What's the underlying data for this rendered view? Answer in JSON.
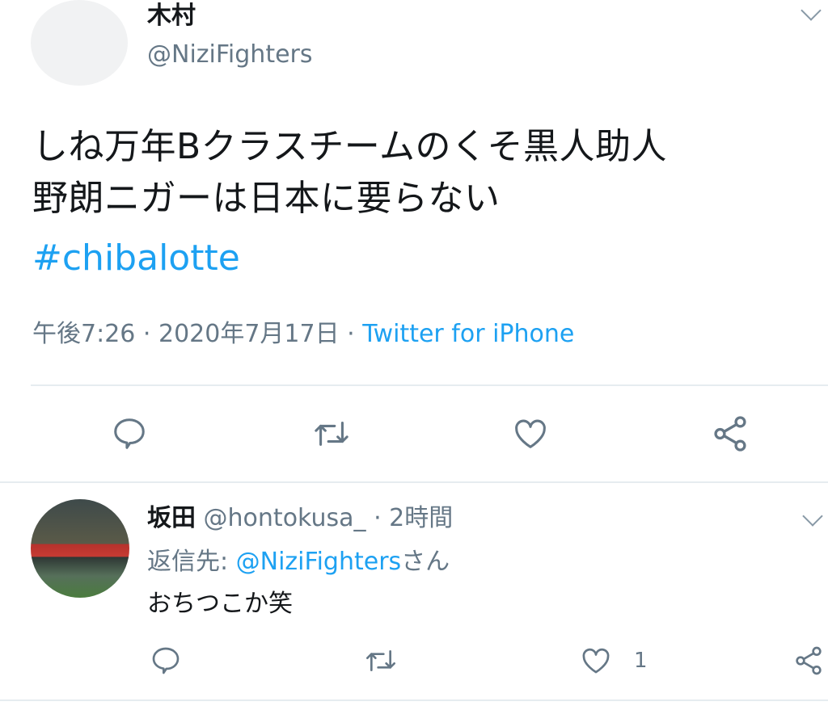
{
  "main_tweet": {
    "author_name": "木村",
    "author_handle": "@NiziFighters",
    "text_line1": "しね万年Bクラスチームのくそ黒人助人",
    "text_line2": "野朗ニガーは日本に要らない",
    "hashtag": "#chibalotte",
    "time": "午後7:26",
    "date": "2020年7月17日",
    "separator": " · ",
    "source": "Twitter for iPhone",
    "actions": {
      "reply_icon": "reply-icon",
      "retweet_icon": "retweet-icon",
      "like_icon": "heart-icon",
      "share_icon": "share-icon"
    }
  },
  "reply_tweet": {
    "author_name": "坂田",
    "author_handle": "@hontokusa_",
    "time_ago": "2時間",
    "separator": " · ",
    "reply_to_label": "返信先: ",
    "reply_to_handle": "@NiziFighters",
    "reply_to_suffix": "さん",
    "text": "おちつこか笑",
    "like_count": "1"
  },
  "colors": {
    "text": "#14171a",
    "secondary": "#657786",
    "link": "#1da1f2",
    "divider": "#e6ecf0"
  }
}
